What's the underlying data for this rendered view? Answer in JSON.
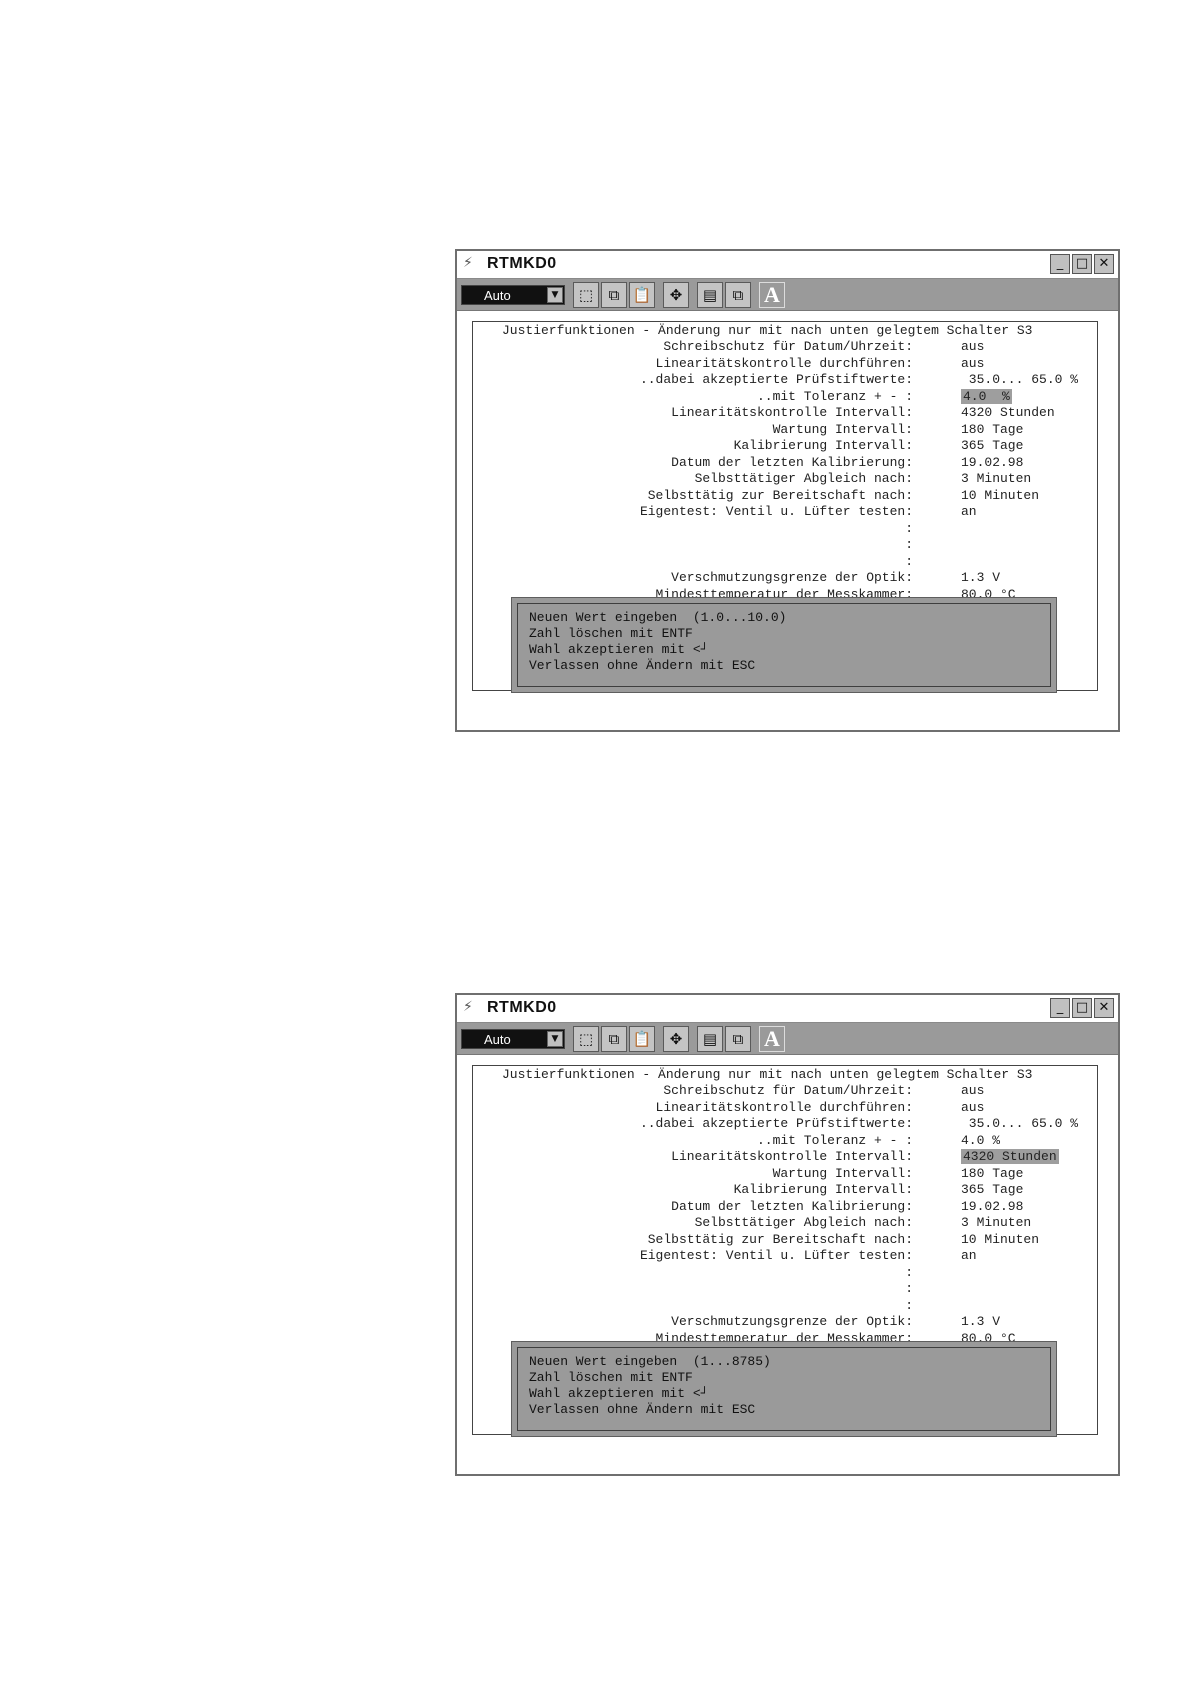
{
  "windows": [
    {
      "title": "RTMKD0",
      "combo_value": "Auto",
      "frame_title": "Justierfunktionen - Änderung nur mit nach unten gelegtem Schalter S3",
      "rows": [
        {
          "label": "Schreibschutz für Datum/Uhrzeit:",
          "value": "aus"
        },
        {
          "label": "Linearitätskontrolle durchführen:",
          "value": "aus"
        },
        {
          "label": "..dabei akzeptierte Prüfstiftwerte:",
          "value": " 35.0... 65.0 %"
        },
        {
          "label": "..mit Toleranz + - :",
          "value": "4.0  %",
          "highlight": true
        },
        {
          "label": "Linearitätskontrolle Intervall:",
          "value": "4320 Stunden"
        },
        {
          "label": "Wartung Intervall:",
          "value": "180 Tage"
        },
        {
          "label": "Kalibrierung Intervall:",
          "value": "365 Tage"
        },
        {
          "label": "Datum der letzten Kalibrierung:",
          "value": "19.02.98"
        },
        {
          "label": "Selbsttätiger Abgleich nach:",
          "value": "3 Minuten"
        },
        {
          "label": "Selbsttätig zur Bereitschaft nach:",
          "value": "10 Minuten"
        },
        {
          "label": "Eigentest: Ventil u. Lüfter testen:",
          "value": "an"
        },
        {
          "label": ":",
          "value": ""
        },
        {
          "label": ":",
          "value": ""
        },
        {
          "label": ":",
          "value": ""
        },
        {
          "label": "Verschmutzungsgrenze der Optik:",
          "value": "1.3 V"
        },
        {
          "label": "Mindesttemperatur der Messkammer:",
          "value": "80.0 °C"
        }
      ],
      "message": [
        "Neuen Wert eingeben  (1.0...10.0)",
        "Zahl löschen mit ENTF",
        "Wahl akzeptieren mit <┘",
        "Verlassen ohne Ändern mit ESC"
      ]
    },
    {
      "title": "RTMKD0",
      "combo_value": "Auto",
      "frame_title": "Justierfunktionen - Änderung nur mit nach unten gelegtem Schalter S3",
      "rows": [
        {
          "label": "Schreibschutz für Datum/Uhrzeit:",
          "value": "aus"
        },
        {
          "label": "Linearitätskontrolle durchführen:",
          "value": "aus"
        },
        {
          "label": "..dabei akzeptierte Prüfstiftwerte:",
          "value": " 35.0... 65.0 %"
        },
        {
          "label": "..mit Toleranz + - :",
          "value": "4.0 %"
        },
        {
          "label": "Linearitätskontrolle Intervall:",
          "value": "4320 Stunden",
          "highlight": true
        },
        {
          "label": "Wartung Intervall:",
          "value": "180 Tage"
        },
        {
          "label": "Kalibrierung Intervall:",
          "value": "365 Tage"
        },
        {
          "label": "Datum der letzten Kalibrierung:",
          "value": "19.02.98"
        },
        {
          "label": "Selbsttätiger Abgleich nach:",
          "value": "3 Minuten"
        },
        {
          "label": "Selbsttätig zur Bereitschaft nach:",
          "value": "10 Minuten"
        },
        {
          "label": "Eigentest: Ventil u. Lüfter testen:",
          "value": "an"
        },
        {
          "label": ":",
          "value": ""
        },
        {
          "label": ":",
          "value": ""
        },
        {
          "label": ":",
          "value": ""
        },
        {
          "label": "Verschmutzungsgrenze der Optik:",
          "value": "1.3 V"
        },
        {
          "label": "Mindesttemperatur der Messkammer:",
          "value": "80.0 °C"
        }
      ],
      "message": [
        "Neuen Wert eingeben  (1...8785)",
        "Zahl löschen mit ENTF",
        "Wahl akzeptieren mit <┘",
        "Verlassen ohne Ändern mit ESC"
      ]
    }
  ]
}
